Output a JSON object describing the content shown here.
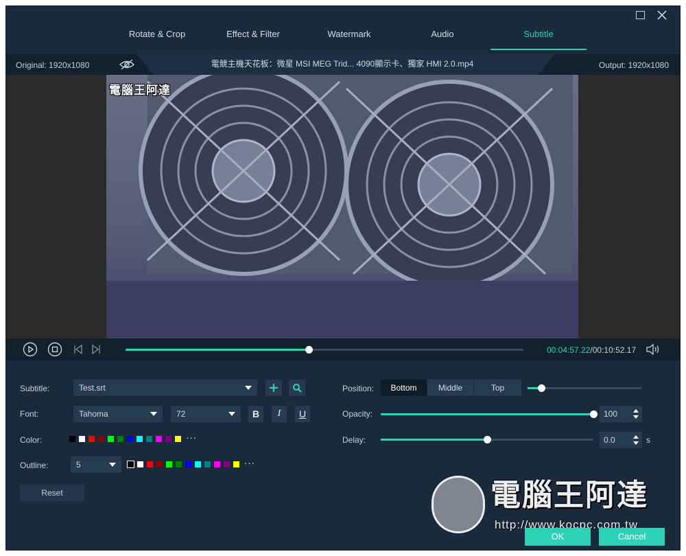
{
  "tabs": [
    {
      "label": "Rotate & Crop"
    },
    {
      "label": "Effect & Filter"
    },
    {
      "label": "Watermark"
    },
    {
      "label": "Audio"
    },
    {
      "label": "Subtitle",
      "active": true
    }
  ],
  "info": {
    "original": "Original: 1920x1080",
    "filename": "電競主機天花板：微星 MSI MEG Trid... 4090顯示卡、獨家 HMI 2.0.mp4",
    "output": "Output: 1920x1080"
  },
  "preview": {
    "watermark_text": "電腦王阿達"
  },
  "playback": {
    "progress": 0.46,
    "current_time": "00:04:57.22",
    "total_time": "/00:10:52.17"
  },
  "subtitle": {
    "label": "Subtitle:",
    "file": "Test.srt"
  },
  "font": {
    "label": "Font:",
    "family": "Tahoma",
    "size": "72",
    "bold": "B",
    "italic": "I",
    "underline": "U"
  },
  "color": {
    "label": "Color:",
    "swatches": [
      "#000000",
      "#ffffff",
      "#ff0000",
      "#8b0000",
      "#00ff00",
      "#008000",
      "#0000ff",
      "#00ffff",
      "#008080",
      "#ff00ff",
      "#800080",
      "#ffff00"
    ],
    "more": "···"
  },
  "outline": {
    "label": "Outline:",
    "width": "5",
    "swatches": [
      "#000000",
      "#ffffff",
      "#ff0000",
      "#8b0000",
      "#00ff00",
      "#008000",
      "#0000ff",
      "#00ffff",
      "#008080",
      "#ff00ff",
      "#800080",
      "#ffff00"
    ],
    "more": "···"
  },
  "reset": "Reset",
  "position": {
    "label": "Position:",
    "options": [
      "Bottom",
      "Middle",
      "Top"
    ],
    "selected": "Bottom",
    "offset": 0.12
  },
  "opacity": {
    "label": "Opacity:",
    "value": "100",
    "fraction": 1.0
  },
  "delay": {
    "label": "Delay:",
    "value": "0.0",
    "unit": "s",
    "fraction": 0.5
  },
  "branding": {
    "title": "電腦王阿達",
    "url": "http://www.kocpc.com.tw"
  },
  "actions": {
    "ok": "OK",
    "cancel": "Cancel"
  },
  "colors": {
    "accent": "#2dd1b6",
    "window": "#192a3b"
  }
}
